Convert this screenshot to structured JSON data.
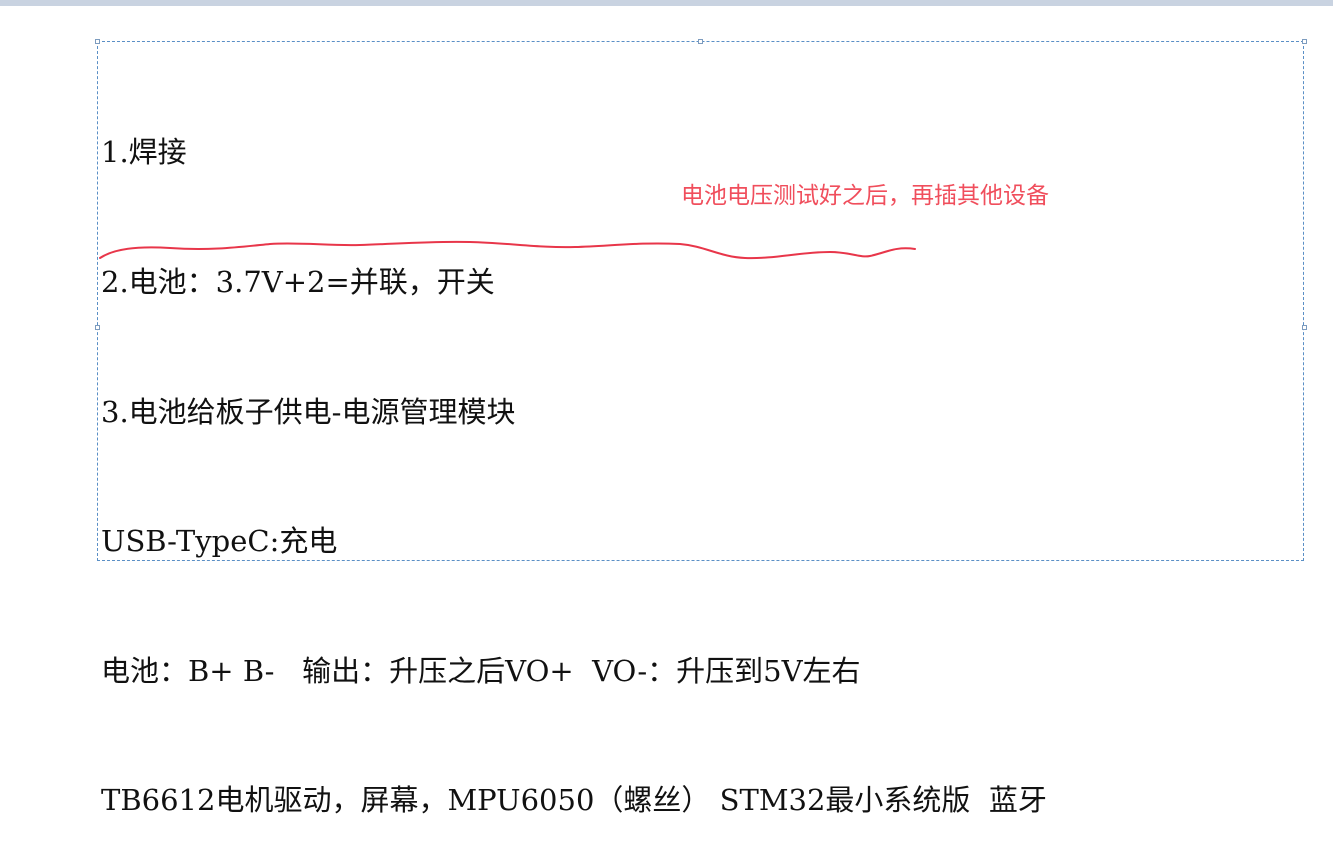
{
  "document": {
    "lines": [
      "1.焊接",
      "2.电池：3.7V+2=并联，开关",
      "3.电池给板子供电-电源管理模块",
      "USB-TypeC:充电",
      "电池：B+ B-   输出：升压之后VO+  VO-：升压到5V左右",
      "TB6612电机驱动，屏幕，MPU6050（螺丝） STM32最小系统版  蓝牙"
    ]
  },
  "annotation": {
    "text": "电池电压测试好之后，再插其他设备",
    "color": "#f04e5c"
  }
}
